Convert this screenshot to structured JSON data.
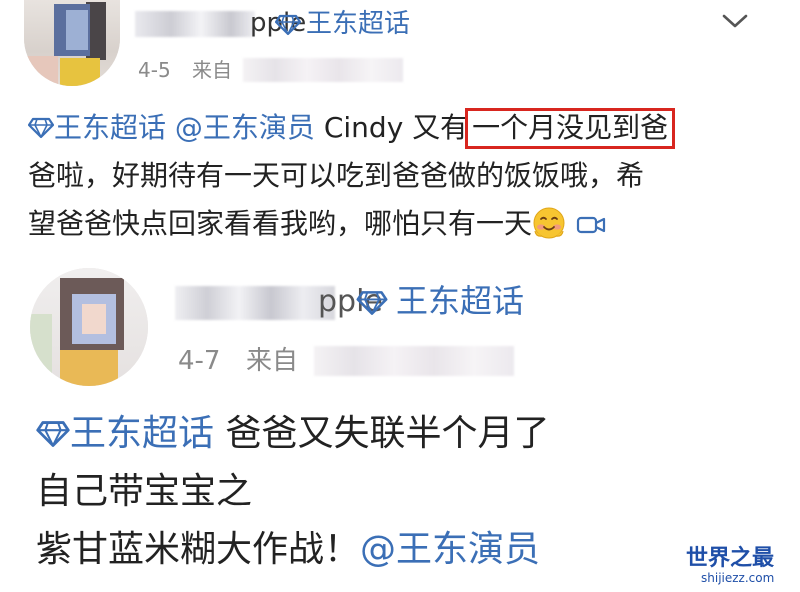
{
  "post1": {
    "username_tail": "pple",
    "topic_tag": "王东超话",
    "date": "4-5",
    "source_prefix": "来自",
    "content": {
      "line1_tag": "王东超话",
      "line1_mention": "@王东演员",
      "line1_text_before": " Cindy 又有",
      "line1_highlight": "一个月没见到爸",
      "line2_text": "爸啦，好期待有一天可以吃到爸爸做的饭饭哦，希",
      "line3_text": "望爸爸快点回家看看我哟，哪怕只有一天"
    },
    "emoji_name": "blushing-face-icon",
    "media_icon_name": "video-camera-icon"
  },
  "post2": {
    "username_tail": "pple",
    "topic_tag": "王东超话",
    "date": "4-7",
    "source_prefix": "来自",
    "content": {
      "line1_tag": "王东超话",
      "line1_text": " 爸爸又失联半个月了",
      "line2_text": "自己带宝宝之",
      "line3_text": "紫甘蓝米糊大作战！",
      "line3_mention": "@王东演员"
    }
  },
  "watermark": {
    "title": "世界之最",
    "url": "shijiezz.com"
  },
  "colors": {
    "link": "#3b6fb6",
    "highlight_border": "#d8261f",
    "text": "#222222",
    "meta": "#8a8a8a",
    "watermark": "#1f4fa8"
  }
}
